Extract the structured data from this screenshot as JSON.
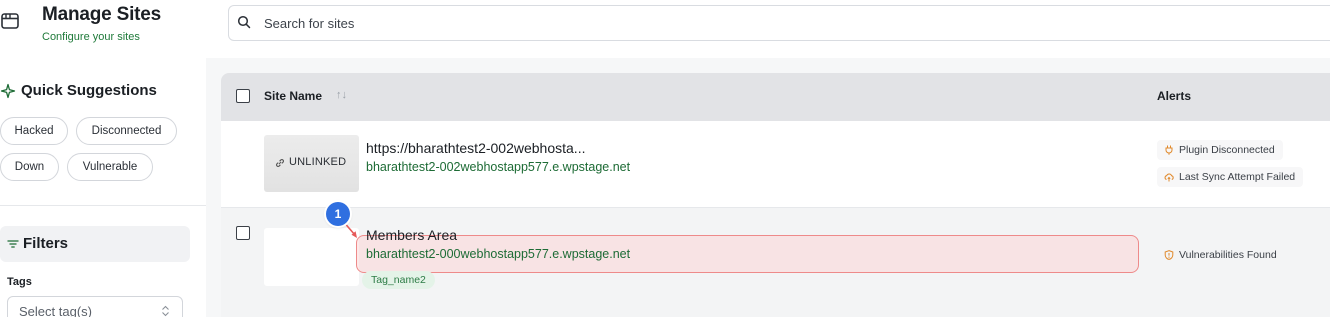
{
  "header": {
    "title": "Manage Sites",
    "subtitle": "Configure your sites",
    "icon": "window-icon",
    "search_placeholder": "Search for sites"
  },
  "sidebar": {
    "quick_suggestions": {
      "title": "Quick Suggestions",
      "icon": "sparkle-icon",
      "chips": [
        "Hacked",
        "Disconnected",
        "Down",
        "Vulnerable"
      ]
    },
    "filters": {
      "title": "Filters",
      "icon": "filter-icon",
      "tags_label": "Tags",
      "tags_placeholder": "Select tag(s)"
    }
  },
  "table": {
    "columns": {
      "site_name": "Site Name",
      "sort_glyph": "↑↓",
      "alerts": "Alerts"
    },
    "rows": [
      {
        "thumbnail_text": "UNLINKED",
        "title": "https://bharathtest2-002webhosta...",
        "url": "bharathtest2-002webhostapp577.e.wpstage.net",
        "alerts": [
          "Plugin Disconnected",
          "Last Sync Attempt Failed"
        ]
      },
      {
        "title": "Members Area",
        "url": "bharathtest2-000webhostapp577.e.wpstage.net",
        "tag": "Tag_name2",
        "alerts": [
          "Vulnerabilities Found"
        ]
      }
    ]
  },
  "annotation": {
    "marker_number": "1",
    "marker_color": "#2f6fe0",
    "highlight_color": "#ee8a8a"
  },
  "colors": {
    "accent_green": "#1d6b35",
    "alert_orange": "#e0892b"
  }
}
